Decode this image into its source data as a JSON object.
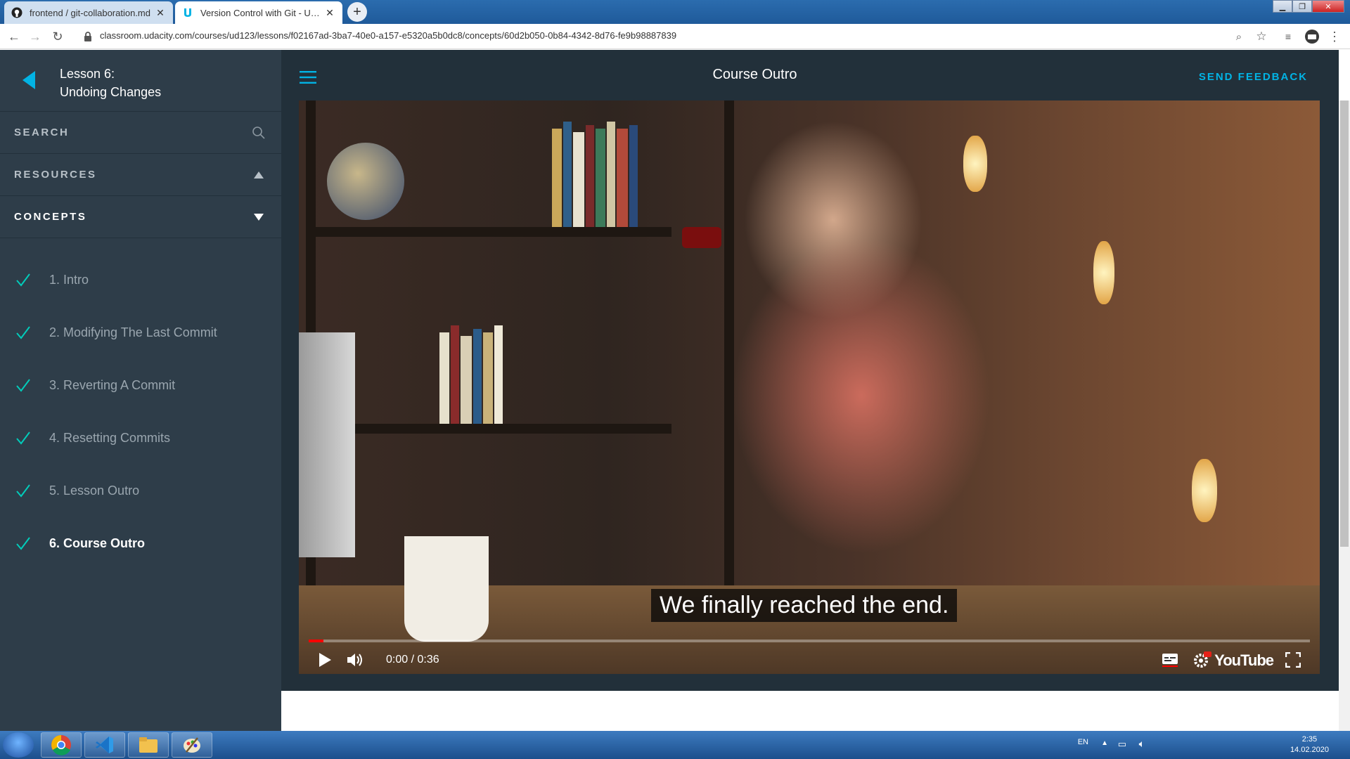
{
  "browser": {
    "tabs": [
      {
        "title": "frontend / git-collaboration.md",
        "icon": "github-icon",
        "active": false
      },
      {
        "title": "Version Control with Git - Udacity",
        "icon": "udacity-icon",
        "active": true
      }
    ],
    "new_tab": "+",
    "url": "classroom.udacity.com/courses/ud123/lessons/f02167ad-3ba7-40e0-a157-e5320a5b0dc8/concepts/60d2b050-0b84-4342-8d76-fe9b98887839"
  },
  "sidebar": {
    "lesson_number": "Lesson 6:",
    "lesson_name": "Undoing Changes",
    "search_label": "SEARCH",
    "resources_label": "RESOURCES",
    "concepts_label": "CONCEPTS",
    "concepts": [
      {
        "label": "1. Intro",
        "completed": true
      },
      {
        "label": "2. Modifying The Last Commit",
        "completed": true
      },
      {
        "label": "3. Reverting A Commit",
        "completed": true
      },
      {
        "label": "4. Resetting Commits",
        "completed": true
      },
      {
        "label": "5. Lesson Outro",
        "completed": true
      },
      {
        "label": "6. Course Outro",
        "completed": true,
        "current": true
      }
    ]
  },
  "header": {
    "title": "Course Outro",
    "feedback_label": "SEND FEEDBACK"
  },
  "video": {
    "subtitle": "We finally reached the end.",
    "time": "0:00 / 0:36",
    "progress": 0.015,
    "brand": "YouTube"
  },
  "taskbar": {
    "language": "EN",
    "time": "2:35",
    "date": "14.02.2020"
  },
  "colors": {
    "accent": "#02b3e4",
    "sidebar_bg": "#2e3d49",
    "header_bg": "#22303a",
    "check": "#02ccba"
  }
}
